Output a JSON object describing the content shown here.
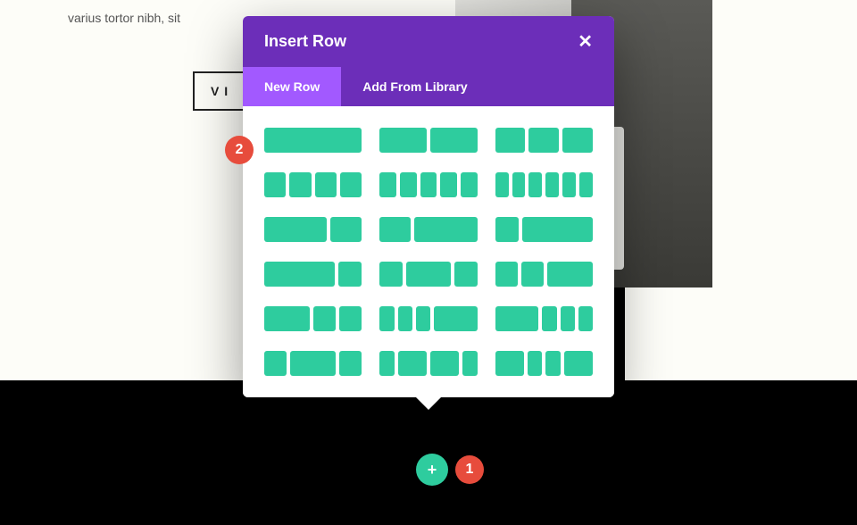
{
  "page": {
    "body_text": "varius tortor nibh, sit",
    "button_label_visible": "V I"
  },
  "modal": {
    "title": "Insert Row",
    "close_icon": "✕",
    "tabs": {
      "new_row": "New Row",
      "add_from_library": "Add From Library"
    },
    "layouts": [
      {
        "name": "full",
        "cols": [
          1
        ]
      },
      {
        "name": "half-half",
        "cols": [
          1,
          1
        ]
      },
      {
        "name": "thirds",
        "cols": [
          1,
          1,
          1
        ]
      },
      {
        "name": "quarters",
        "cols": [
          1,
          1,
          1,
          1
        ]
      },
      {
        "name": "fifths",
        "cols": [
          1,
          1,
          1,
          1,
          1
        ]
      },
      {
        "name": "sixths",
        "cols": [
          1,
          1,
          1,
          1,
          1,
          1
        ]
      },
      {
        "name": "two-third-third",
        "cols": [
          2,
          1
        ]
      },
      {
        "name": "third-two-third",
        "cols": [
          1,
          2
        ]
      },
      {
        "name": "quarter-three-quarter",
        "cols": [
          1,
          3
        ]
      },
      {
        "name": "three-quarter-quarter",
        "cols": [
          3,
          1
        ]
      },
      {
        "name": "quarter-half-quarter",
        "cols": [
          1,
          2,
          1
        ]
      },
      {
        "name": "quarter-quarter-half",
        "cols": [
          1,
          1,
          2
        ]
      },
      {
        "name": "half-quarter-quarter",
        "cols": [
          2,
          1,
          1
        ]
      },
      {
        "name": "sixth-sixth-sixth-half",
        "cols": [
          1,
          1,
          1,
          3
        ]
      },
      {
        "name": "half-sixth-sixth-sixth",
        "cols": [
          3,
          1,
          1,
          1
        ]
      },
      {
        "name": "quarter-half-quarter-b",
        "cols": [
          1,
          2,
          1
        ]
      },
      {
        "name": "sixth-third-third-sixth",
        "cols": [
          1,
          2,
          2,
          1
        ]
      },
      {
        "name": "third-sixth-sixth-third",
        "cols": [
          2,
          1,
          1,
          2
        ]
      }
    ]
  },
  "annotations": {
    "badge_1": "1",
    "badge_2": "2"
  },
  "add_button": {
    "icon": "+"
  }
}
